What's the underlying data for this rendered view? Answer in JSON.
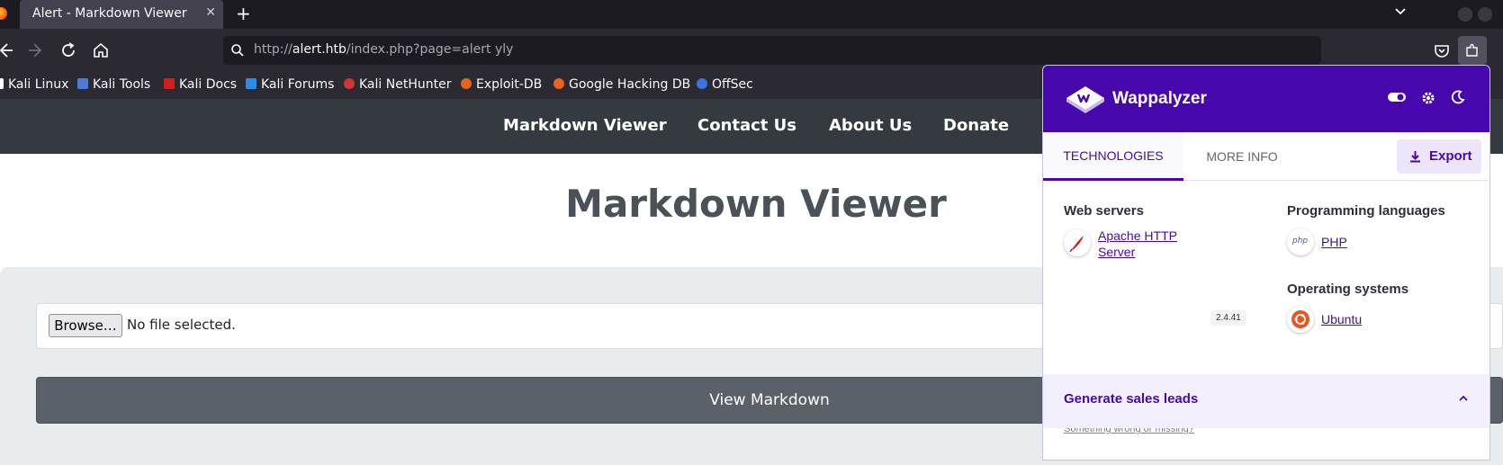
{
  "browser": {
    "tab_title": "Alert - Markdown Viewer",
    "url_prefix": "http://",
    "url_host": "alert.htb",
    "url_path": "/index.php?page=alert yly"
  },
  "bookmarks": [
    {
      "label": "Kali Linux",
      "color": "#367bf0"
    },
    {
      "label": "Kali Tools",
      "color": "#e94b3c"
    },
    {
      "label": "Kali Docs",
      "color": "#d21e1e"
    },
    {
      "label": "Kali Forums",
      "color": "#2a8ee8"
    },
    {
      "label": "Kali NetHunter",
      "color": "#d13535"
    },
    {
      "label": "Exploit-DB",
      "color": "#e8641b"
    },
    {
      "label": "Google Hacking DB",
      "color": "#e8641b"
    },
    {
      "label": "OffSec",
      "color": "#3a74e0"
    }
  ],
  "site": {
    "nav": [
      "Markdown Viewer",
      "Contact Us",
      "About Us",
      "Donate"
    ],
    "title": "Markdown Viewer",
    "browse_label": "Browse…",
    "file_status": "No file selected.",
    "view_button": "View Markdown"
  },
  "wappalyzer": {
    "name": "Wappalyzer",
    "tabs": {
      "technologies": "TECHNOLOGIES",
      "more_info": "MORE INFO"
    },
    "export_label": "Export",
    "categories": {
      "web_servers": {
        "title": "Web servers",
        "tech_line1": "Apache HTTP",
        "tech_line2": "Server",
        "version": "2.4.41"
      },
      "programming_languages": {
        "title": "Programming languages",
        "tech": "PHP"
      },
      "operating_systems": {
        "title": "Operating systems",
        "tech": "Ubuntu"
      }
    },
    "wrong_link": "Something wrong or missing?",
    "sales_leads": "Generate sales leads",
    "accent_color": "#4608ad"
  }
}
